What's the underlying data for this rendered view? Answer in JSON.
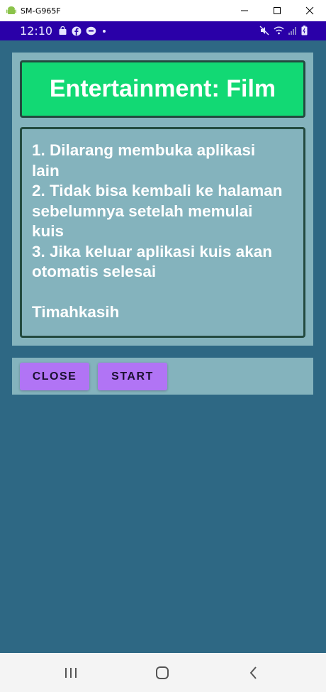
{
  "window": {
    "title": "SM-G965F",
    "icon": "android-icon",
    "controls": [
      "minimize-icon",
      "maximize-icon",
      "close-icon"
    ]
  },
  "status_bar": {
    "time": "12:10",
    "left_icons": [
      "bag-icon",
      "facebook-icon",
      "message-icon",
      "dot-icon"
    ],
    "right_icons": [
      "mute-icon",
      "wifi-icon",
      "signal-icon",
      "battery-icon"
    ],
    "background": "#2a00a8"
  },
  "quiz": {
    "category_title": "Entertainment: Film",
    "rules": [
      "1. Dilarang membuka aplikasi",
      "lain",
      "2. Tidak bisa kembali ke halaman",
      "sebelumnya setelah memulai",
      "kuis",
      "3. Jika keluar aplikasi kuis akan",
      "otomatis selesai"
    ],
    "closing": "Timahkasih"
  },
  "buttons": {
    "close_label": "CLOSE",
    "start_label": "START"
  },
  "nav_bar": {
    "items": [
      "recent-apps-icon",
      "home-icon",
      "back-icon"
    ]
  },
  "colors": {
    "app_background": "#2e6884",
    "card_background": "#84b3bd",
    "title_background": "#12d974",
    "border": "#234a3f",
    "button": "#b174f5"
  }
}
